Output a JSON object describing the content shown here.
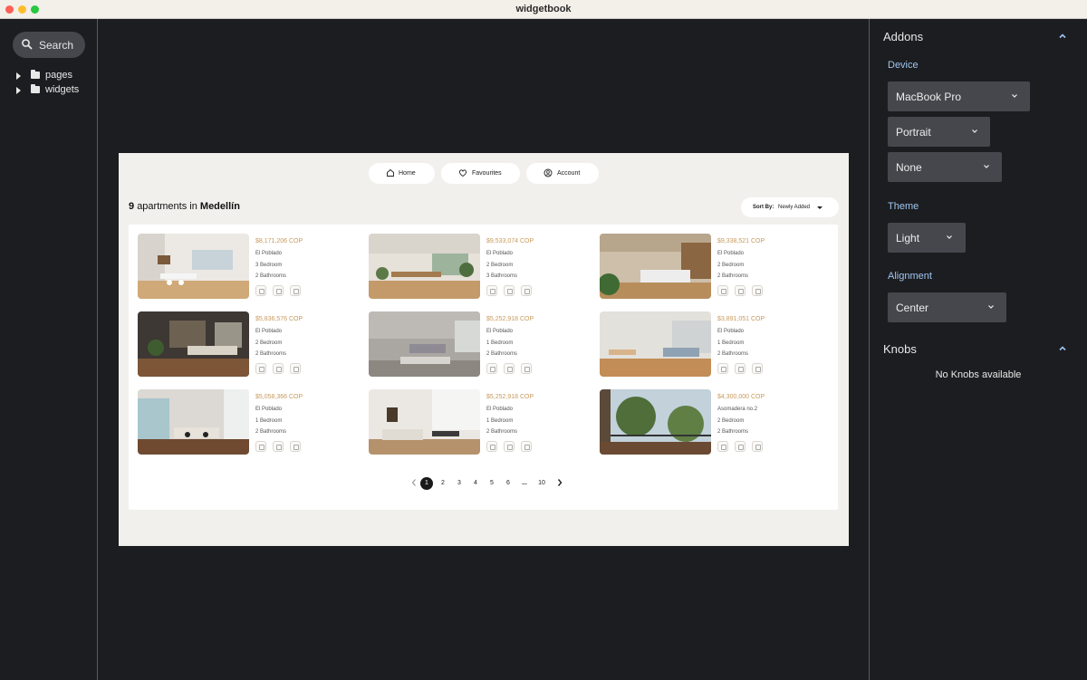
{
  "window": {
    "title": "widgetbook"
  },
  "navigator": {
    "search_label": "Search",
    "tree": [
      {
        "label": "pages",
        "icon": "folder-icon"
      },
      {
        "label": "widgets",
        "icon": "folder-icon"
      }
    ]
  },
  "addons": {
    "header": "Addons",
    "device_label": "Device",
    "device_value": "MacBook Pro",
    "orientation_value": "Portrait",
    "frame_value": "None",
    "theme_label": "Theme",
    "theme_value": "Light",
    "alignment_label": "Alignment",
    "alignment_value": "Center"
  },
  "knobs": {
    "header": "Knobs",
    "empty_text": "No Knobs available"
  },
  "app": {
    "nav": [
      {
        "label": "Home",
        "icon": "home-icon"
      },
      {
        "label": "Favourites",
        "icon": "heart-icon"
      },
      {
        "label": "Account",
        "icon": "account-icon"
      }
    ],
    "heading": {
      "count": "9",
      "middle": "apartments in",
      "city": "Medellín"
    },
    "sort": {
      "label": "Sort By:",
      "value": "Newly Added"
    },
    "listings": [
      {
        "price": "$8,171,206 COP",
        "area": "El Poblado",
        "beds": "3 Bedroom",
        "baths": "2 Bathrooms",
        "amenities": [
          "shield-icon",
          "building-icon",
          "tv-icon"
        ]
      },
      {
        "price": "$9,533,074 COP",
        "area": "El Poblado",
        "beds": "2 Bedroom",
        "baths": "3 Bathrooms",
        "amenities": [
          "shield-icon",
          "gear-icon",
          "building-icon"
        ]
      },
      {
        "price": "$9,338,521 COP",
        "area": "El Poblado",
        "beds": "2 Bedroom",
        "baths": "2 Bathrooms",
        "amenities": [
          "shield-icon",
          "tv-icon",
          "wifi-icon"
        ]
      },
      {
        "price": "$5,836,576 COP",
        "area": "El Poblado",
        "beds": "2 Bedroom",
        "baths": "2 Bathrooms",
        "amenities": [
          "shield-icon",
          "tv-icon",
          "wifi-icon"
        ]
      },
      {
        "price": "$5,252,918 COP",
        "area": "El Poblado",
        "beds": "1 Bedroom",
        "baths": "2 Bathrooms",
        "amenities": [
          "shield-icon",
          "building-icon",
          "tv-icon"
        ]
      },
      {
        "price": "$3,891,051 COP",
        "area": "El Poblado",
        "beds": "1 Bedroom",
        "baths": "2 Bathrooms",
        "amenities": [
          "shield-icon",
          "building-icon",
          "wifi-icon"
        ]
      },
      {
        "price": "$5,058,366 COP",
        "area": "El Poblado",
        "beds": "1 Bedroom",
        "baths": "2 Bathrooms",
        "amenities": [
          "shield-icon",
          "building-icon",
          "tools-icon"
        ]
      },
      {
        "price": "$5,252,918 COP",
        "area": "El Poblado",
        "beds": "1 Bedroom",
        "baths": "2 Bathrooms",
        "amenities": [
          "shield-icon",
          "gear-icon",
          "tv-icon"
        ]
      },
      {
        "price": "$4,300,000 COP",
        "area": "Asomadera no.2",
        "beds": "2 Bedroom",
        "baths": "2 Bathrooms",
        "amenities": [
          "building-icon",
          "tv-icon",
          "shield-icon"
        ]
      }
    ],
    "pagination": {
      "pages": [
        "1",
        "2",
        "3",
        "4",
        "5",
        "6",
        "...",
        "10"
      ],
      "current": "1"
    }
  },
  "colors": {
    "accent_blue": "#9ec6f2",
    "price_gold": "#c79a5c",
    "panel_bg": "#1c1d20",
    "dropdown_bg": "#45474d",
    "preview_bg": "#f2f0ed"
  }
}
